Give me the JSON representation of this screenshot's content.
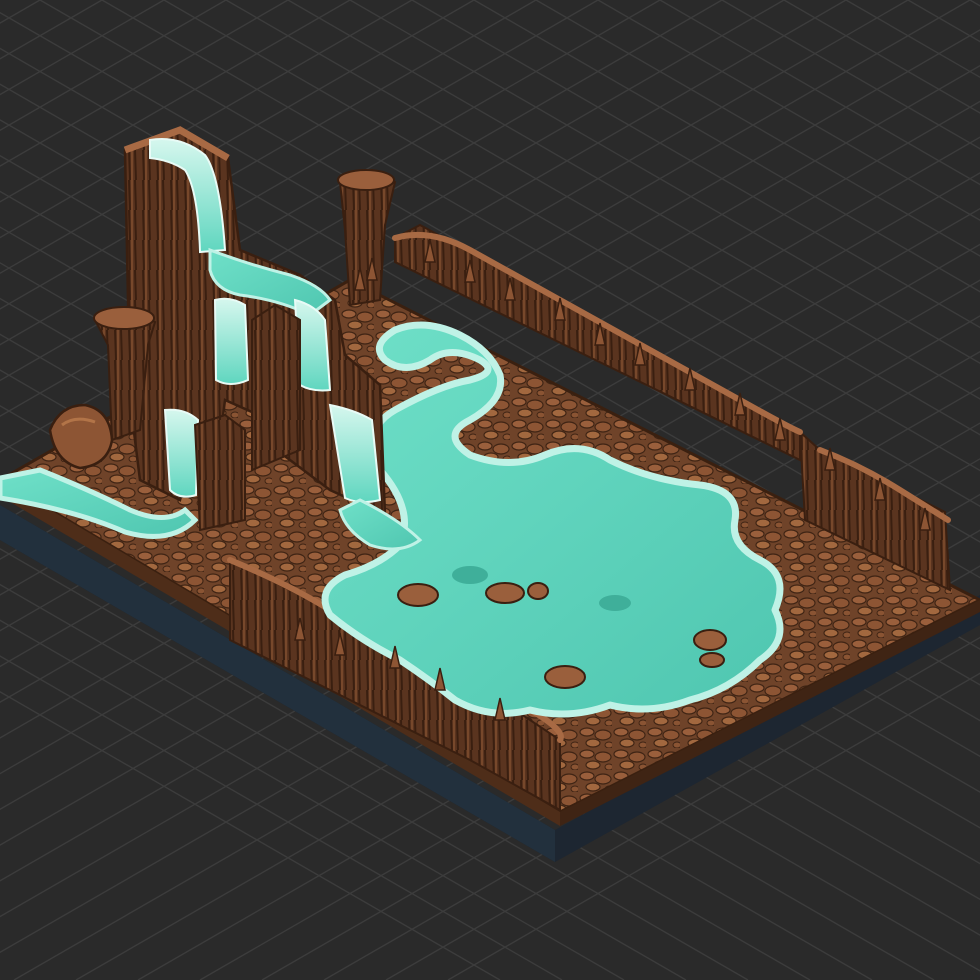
{
  "viewport": {
    "background": "#2a2a2a",
    "grid_color": "#3c3c3c",
    "projection": "isometric"
  },
  "model": {
    "colors": {
      "rock": "#7a4a2e",
      "rock_dark": "#4a2a18",
      "rock_light": "#a86a44",
      "water": "#5fd6bf",
      "water_foam": "#bff2e6",
      "base": "#1d2631"
    }
  }
}
